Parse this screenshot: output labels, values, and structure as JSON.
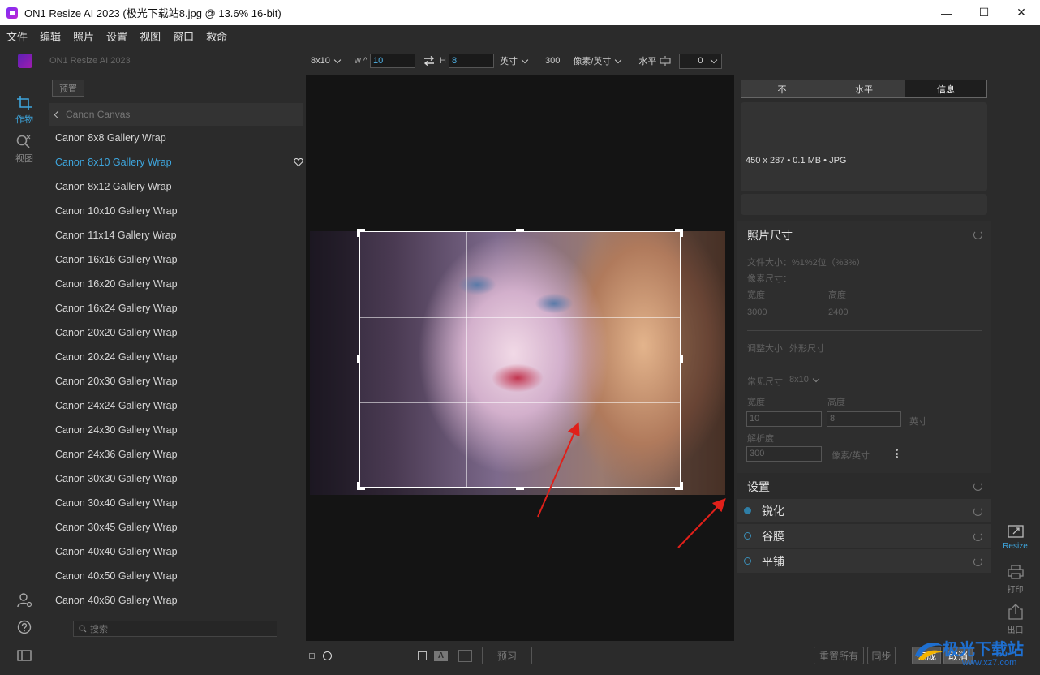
{
  "window": {
    "title": "ON1 Resize AI 2023 (极光下载站8.jpg @ 13.6% 16-bit)",
    "controls": [
      "—",
      "☐",
      "✕"
    ]
  },
  "menu": [
    "文件",
    "编辑",
    "照片",
    "设置",
    "视图",
    "窗口",
    "救命"
  ],
  "rail": {
    "crop_label": "作物",
    "view_label": "视图"
  },
  "toolbar": {
    "app_name": "ON1 Resize AI 2023",
    "preset_size": "8x10",
    "w_label": "w ^",
    "w_value": "10",
    "h_label": "H",
    "h_value": "8",
    "unit": "英寸",
    "resolution": "300",
    "res_unit": "像素/英寸",
    "orientation_label": "水平",
    "angle_value": "0"
  },
  "presets": {
    "tab_label": "预置",
    "breadcrumb": "Canon Canvas",
    "items": [
      "Canon 8x8 Gallery Wrap",
      "Canon 8x10 Gallery Wrap",
      "Canon 8x12 Gallery Wrap",
      "Canon 10x10 Gallery Wrap",
      "Canon 11x14 Gallery Wrap",
      "Canon 16x16 Gallery Wrap",
      "Canon 16x20 Gallery Wrap",
      "Canon 16x24 Gallery Wrap",
      "Canon 20x20 Gallery Wrap",
      "Canon 20x24 Gallery Wrap",
      "Canon 20x30 Gallery Wrap",
      "Canon 24x24 Gallery Wrap",
      "Canon 24x30 Gallery Wrap",
      "Canon 24x36 Gallery Wrap",
      "Canon 30x30 Gallery Wrap",
      "Canon 30x40 Gallery Wrap",
      "Canon 30x45 Gallery Wrap",
      "Canon 40x40 Gallery Wrap",
      "Canon 40x50 Gallery Wrap",
      "Canon 40x60 Gallery Wrap"
    ],
    "selected_index": 1,
    "search_placeholder": "搜索"
  },
  "right_panel": {
    "tabs": [
      "不",
      "水平",
      "信息"
    ],
    "image_info": "450 x 287 • 0.1 MB • JPG",
    "photo_size": {
      "title": "照片尺寸",
      "file_size": "文件大小：%1%2位（%3%）",
      "pixel_size": "像素尺寸：",
      "width_label": "宽度",
      "height_label": "高度",
      "pixel_width": "3000",
      "pixel_height": "2400",
      "resize_label": "调整大小",
      "shape_label": "外形尺寸",
      "common_size_label": "常见尺寸",
      "common_size_value": "8x10",
      "width_label2": "宽度",
      "height_label2": "高度",
      "width_value": "10",
      "height_value": "8",
      "unit": "英寸",
      "resolution_label": "解析度",
      "resolution_value": "300",
      "resolution_unit": "像素/英寸"
    },
    "settings": {
      "title": "设置",
      "items": [
        {
          "label": "锐化",
          "on": true
        },
        {
          "label": "谷膜",
          "on": false
        },
        {
          "label": "平铺",
          "on": false
        }
      ]
    }
  },
  "right_rail": {
    "resize_label": "Resize",
    "print_label": "打印",
    "export_label": "出口"
  },
  "bottom": {
    "preview_label": "预习",
    "reset_all_label": "重置所有",
    "sync_label": "同步",
    "done_label": "完成",
    "cancel_label": "取消"
  },
  "watermark": {
    "text": "极光下载站",
    "url": "www.xz7.com"
  },
  "colors": {
    "accent": "#3ea6de",
    "annotation_arrow": "#e0201a"
  }
}
